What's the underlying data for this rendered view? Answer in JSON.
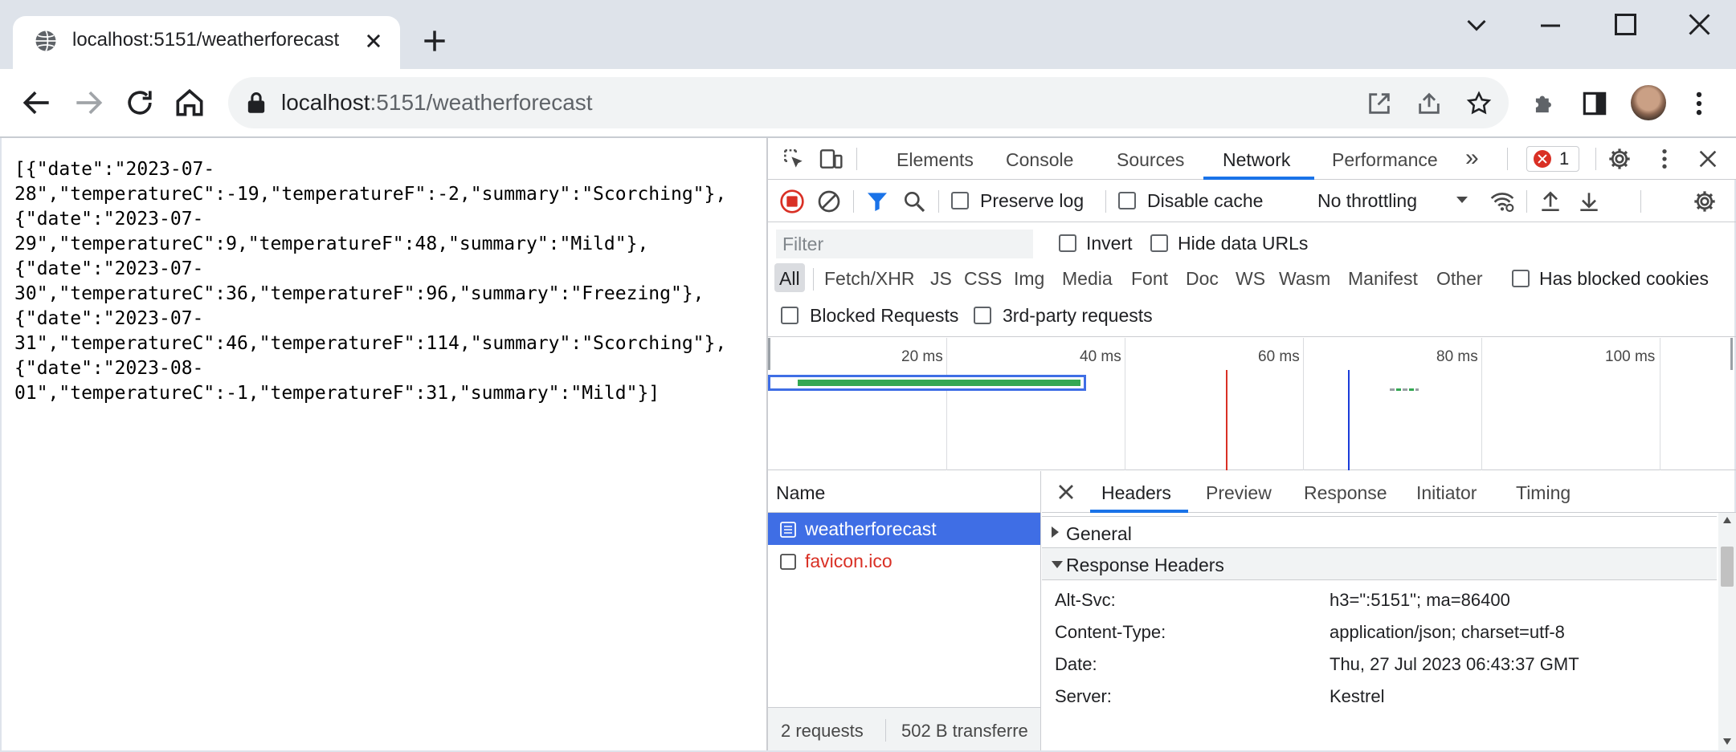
{
  "browser": {
    "tab_title": "localhost:5151/weatherforecast",
    "url_host": "localhost",
    "url_path": ":5151/weatherforecast"
  },
  "page": {
    "json_lines": [
      "[{\"date\":\"2023-07-",
      "28\",\"temperatureC\":-19,\"temperatureF\":-2,\"summary\":\"Scorching\"},",
      "{\"date\":\"2023-07-",
      "29\",\"temperatureC\":9,\"temperatureF\":48,\"summary\":\"Mild\"},",
      "{\"date\":\"2023-07-",
      "30\",\"temperatureC\":36,\"temperatureF\":96,\"summary\":\"Freezing\"},",
      "{\"date\":\"2023-07-",
      "31\",\"temperatureC\":46,\"temperatureF\":114,\"summary\":\"Scorching\"},",
      "{\"date\":\"2023-08-",
      "01\",\"temperatureC\":-1,\"temperatureF\":31,\"summary\":\"Mild\"}]"
    ]
  },
  "devtools": {
    "tabs": [
      "Elements",
      "Console",
      "Sources",
      "Network",
      "Performance"
    ],
    "more_tabs": "»",
    "error_count": "1",
    "network_toolbar": {
      "preserve_log": "Preserve log",
      "disable_cache": "Disable cache",
      "throttling": "No throttling"
    },
    "filter": {
      "placeholder": "Filter",
      "invert": "Invert",
      "hide_data_urls": "Hide data URLs",
      "types": [
        "All",
        "Fetch/XHR",
        "JS",
        "CSS",
        "Img",
        "Media",
        "Font",
        "Doc",
        "WS",
        "Wasm",
        "Manifest",
        "Other"
      ],
      "has_blocked_cookies": "Has blocked cookies",
      "blocked_requests": "Blocked Requests",
      "third_party": "3rd-party requests"
    },
    "overview": {
      "ticks": [
        "20 ms",
        "40 ms",
        "60 ms",
        "80 ms",
        "100 ms"
      ]
    },
    "requests": {
      "header": "Name",
      "items": [
        {
          "name": "weatherforecast"
        },
        {
          "name": "favicon.ico"
        }
      ],
      "summary_count": "2 requests",
      "summary_transfer": "502 B transferre"
    },
    "detail": {
      "tabs": [
        "Headers",
        "Preview",
        "Response",
        "Initiator",
        "Timing"
      ],
      "general": "General",
      "response_headers": "Response Headers",
      "headers": [
        {
          "name": "Alt-Svc:",
          "value": "h3=\":5151\"; ma=86400"
        },
        {
          "name": "Content-Type:",
          "value": "application/json; charset=utf-8"
        },
        {
          "name": "Date:",
          "value": "Thu, 27 Jul 2023 06:43:37 GMT"
        },
        {
          "name": "Server:",
          "value": "Kestrel"
        }
      ]
    }
  },
  "colors": {
    "accent": "#1a73e8",
    "selected_row": "#3f6ee5",
    "error_text": "#d93025"
  }
}
